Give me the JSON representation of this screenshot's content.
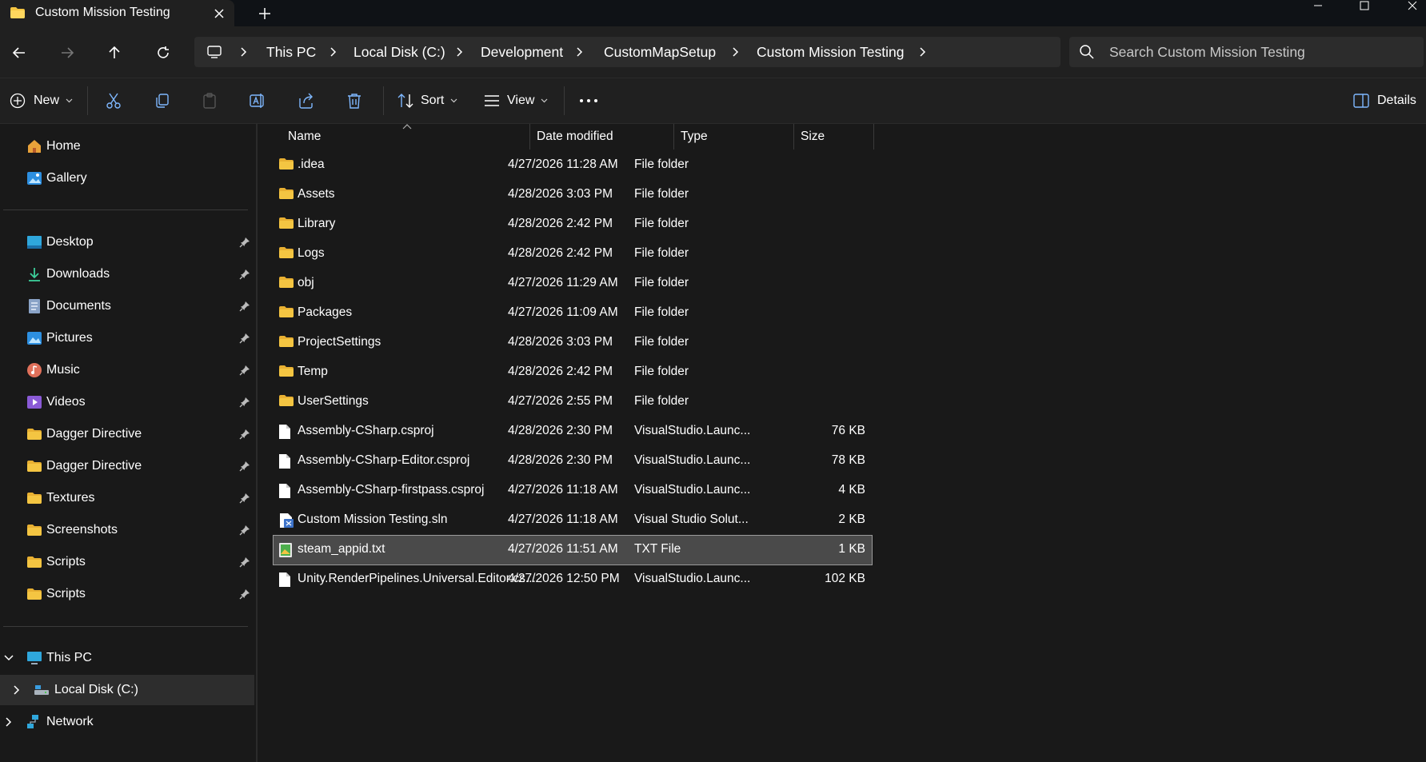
{
  "window": {
    "tab_title": "Custom Mission Testing",
    "minimize": "–",
    "maximize": "□",
    "close": "✕"
  },
  "address": {
    "crumbs": [
      "This PC",
      "Local Disk (C:)",
      "Development",
      "CustomMapSetup",
      "Custom Mission Testing"
    ]
  },
  "search": {
    "placeholder": "Search Custom Mission Testing"
  },
  "toolbar": {
    "new_label": "New",
    "sort_label": "Sort",
    "view_label": "View",
    "details_label": "Details"
  },
  "sidebar": {
    "top": [
      {
        "label": "Home",
        "icon": "home-icon"
      },
      {
        "label": "Gallery",
        "icon": "gallery-icon"
      }
    ],
    "pinned": [
      {
        "label": "Desktop",
        "icon": "desktop-icon"
      },
      {
        "label": "Downloads",
        "icon": "download-icon"
      },
      {
        "label": "Documents",
        "icon": "document-icon"
      },
      {
        "label": "Pictures",
        "icon": "pictures-icon"
      },
      {
        "label": "Music",
        "icon": "music-icon"
      },
      {
        "label": "Videos",
        "icon": "videos-icon"
      },
      {
        "label": "Dagger Directive",
        "icon": "folder-icon"
      },
      {
        "label": "Dagger Directive",
        "icon": "folder-icon"
      },
      {
        "label": "Textures",
        "icon": "folder-icon"
      },
      {
        "label": "Screenshots",
        "icon": "folder-icon"
      },
      {
        "label": "Scripts",
        "icon": "folder-icon"
      },
      {
        "label": "Scripts",
        "icon": "folder-icon"
      }
    ],
    "tree": [
      {
        "label": "This PC",
        "icon": "computer-icon",
        "expanded": true
      },
      {
        "label": "Local Disk (C:)",
        "icon": "drive-icon",
        "expanded": false
      },
      {
        "label": "Network",
        "icon": "network-icon",
        "expanded": false
      }
    ]
  },
  "columns": {
    "name": "Name",
    "date": "Date modified",
    "type": "Type",
    "size": "Size"
  },
  "files": [
    {
      "name": ".idea",
      "date": "4/27/2026 11:28 AM",
      "type": "File folder",
      "size": "",
      "icon": "folder"
    },
    {
      "name": "Assets",
      "date": "4/28/2026 3:03 PM",
      "type": "File folder",
      "size": "",
      "icon": "folder"
    },
    {
      "name": "Library",
      "date": "4/28/2026 2:42 PM",
      "type": "File folder",
      "size": "",
      "icon": "folder"
    },
    {
      "name": "Logs",
      "date": "4/28/2026 2:42 PM",
      "type": "File folder",
      "size": "",
      "icon": "folder"
    },
    {
      "name": "obj",
      "date": "4/27/2026 11:29 AM",
      "type": "File folder",
      "size": "",
      "icon": "folder"
    },
    {
      "name": "Packages",
      "date": "4/27/2026 11:09 AM",
      "type": "File folder",
      "size": "",
      "icon": "folder"
    },
    {
      "name": "ProjectSettings",
      "date": "4/28/2026 3:03 PM",
      "type": "File folder",
      "size": "",
      "icon": "folder"
    },
    {
      "name": "Temp",
      "date": "4/28/2026 2:42 PM",
      "type": "File folder",
      "size": "",
      "icon": "folder"
    },
    {
      "name": "UserSettings",
      "date": "4/27/2026 2:55 PM",
      "type": "File folder",
      "size": "",
      "icon": "folder"
    },
    {
      "name": "Assembly-CSharp.csproj",
      "date": "4/28/2026 2:30 PM",
      "type": "VisualStudio.Launc...",
      "size": "76 KB",
      "icon": "file"
    },
    {
      "name": "Assembly-CSharp-Editor.csproj",
      "date": "4/28/2026 2:30 PM",
      "type": "VisualStudio.Launc...",
      "size": "78 KB",
      "icon": "file"
    },
    {
      "name": "Assembly-CSharp-firstpass.csproj",
      "date": "4/27/2026 11:18 AM",
      "type": "VisualStudio.Launc...",
      "size": "4 KB",
      "icon": "file"
    },
    {
      "name": "Custom Mission Testing.sln",
      "date": "4/27/2026 11:18 AM",
      "type": "Visual Studio Solut...",
      "size": "2 KB",
      "icon": "sln"
    },
    {
      "name": "steam_appid.txt",
      "date": "4/27/2026 11:51 AM",
      "type": "TXT File",
      "size": "1 KB",
      "icon": "txt",
      "selected": true
    },
    {
      "name": "Unity.RenderPipelines.Universal.Editor.cs...",
      "date": "4/27/2026 12:50 PM",
      "type": "VisualStudio.Launc...",
      "size": "102 KB",
      "icon": "file"
    }
  ],
  "colors": {
    "folder": "#f4c542",
    "selection": "#4a4a4a",
    "accent": "#4cc2ff"
  }
}
